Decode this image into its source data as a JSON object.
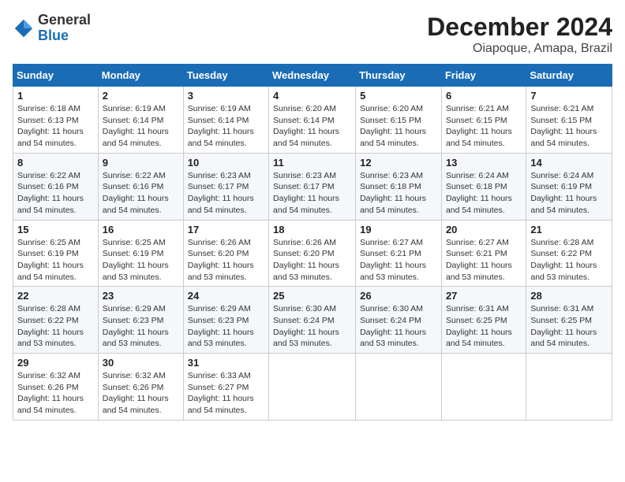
{
  "header": {
    "logo_general": "General",
    "logo_blue": "Blue",
    "month_title": "December 2024",
    "location": "Oiapoque, Amapa, Brazil"
  },
  "weekdays": [
    "Sunday",
    "Monday",
    "Tuesday",
    "Wednesday",
    "Thursday",
    "Friday",
    "Saturday"
  ],
  "weeks": [
    [
      {
        "day": "1",
        "info": "Sunrise: 6:18 AM\nSunset: 6:13 PM\nDaylight: 11 hours\nand 54 minutes."
      },
      {
        "day": "2",
        "info": "Sunrise: 6:19 AM\nSunset: 6:14 PM\nDaylight: 11 hours\nand 54 minutes."
      },
      {
        "day": "3",
        "info": "Sunrise: 6:19 AM\nSunset: 6:14 PM\nDaylight: 11 hours\nand 54 minutes."
      },
      {
        "day": "4",
        "info": "Sunrise: 6:20 AM\nSunset: 6:14 PM\nDaylight: 11 hours\nand 54 minutes."
      },
      {
        "day": "5",
        "info": "Sunrise: 6:20 AM\nSunset: 6:15 PM\nDaylight: 11 hours\nand 54 minutes."
      },
      {
        "day": "6",
        "info": "Sunrise: 6:21 AM\nSunset: 6:15 PM\nDaylight: 11 hours\nand 54 minutes."
      },
      {
        "day": "7",
        "info": "Sunrise: 6:21 AM\nSunset: 6:15 PM\nDaylight: 11 hours\nand 54 minutes."
      }
    ],
    [
      {
        "day": "8",
        "info": "Sunrise: 6:22 AM\nSunset: 6:16 PM\nDaylight: 11 hours\nand 54 minutes."
      },
      {
        "day": "9",
        "info": "Sunrise: 6:22 AM\nSunset: 6:16 PM\nDaylight: 11 hours\nand 54 minutes."
      },
      {
        "day": "10",
        "info": "Sunrise: 6:23 AM\nSunset: 6:17 PM\nDaylight: 11 hours\nand 54 minutes."
      },
      {
        "day": "11",
        "info": "Sunrise: 6:23 AM\nSunset: 6:17 PM\nDaylight: 11 hours\nand 54 minutes."
      },
      {
        "day": "12",
        "info": "Sunrise: 6:23 AM\nSunset: 6:18 PM\nDaylight: 11 hours\nand 54 minutes."
      },
      {
        "day": "13",
        "info": "Sunrise: 6:24 AM\nSunset: 6:18 PM\nDaylight: 11 hours\nand 54 minutes."
      },
      {
        "day": "14",
        "info": "Sunrise: 6:24 AM\nSunset: 6:19 PM\nDaylight: 11 hours\nand 54 minutes."
      }
    ],
    [
      {
        "day": "15",
        "info": "Sunrise: 6:25 AM\nSunset: 6:19 PM\nDaylight: 11 hours\nand 54 minutes."
      },
      {
        "day": "16",
        "info": "Sunrise: 6:25 AM\nSunset: 6:19 PM\nDaylight: 11 hours\nand 53 minutes."
      },
      {
        "day": "17",
        "info": "Sunrise: 6:26 AM\nSunset: 6:20 PM\nDaylight: 11 hours\nand 53 minutes."
      },
      {
        "day": "18",
        "info": "Sunrise: 6:26 AM\nSunset: 6:20 PM\nDaylight: 11 hours\nand 53 minutes."
      },
      {
        "day": "19",
        "info": "Sunrise: 6:27 AM\nSunset: 6:21 PM\nDaylight: 11 hours\nand 53 minutes."
      },
      {
        "day": "20",
        "info": "Sunrise: 6:27 AM\nSunset: 6:21 PM\nDaylight: 11 hours\nand 53 minutes."
      },
      {
        "day": "21",
        "info": "Sunrise: 6:28 AM\nSunset: 6:22 PM\nDaylight: 11 hours\nand 53 minutes."
      }
    ],
    [
      {
        "day": "22",
        "info": "Sunrise: 6:28 AM\nSunset: 6:22 PM\nDaylight: 11 hours\nand 53 minutes."
      },
      {
        "day": "23",
        "info": "Sunrise: 6:29 AM\nSunset: 6:23 PM\nDaylight: 11 hours\nand 53 minutes."
      },
      {
        "day": "24",
        "info": "Sunrise: 6:29 AM\nSunset: 6:23 PM\nDaylight: 11 hours\nand 53 minutes."
      },
      {
        "day": "25",
        "info": "Sunrise: 6:30 AM\nSunset: 6:24 PM\nDaylight: 11 hours\nand 53 minutes."
      },
      {
        "day": "26",
        "info": "Sunrise: 6:30 AM\nSunset: 6:24 PM\nDaylight: 11 hours\nand 53 minutes."
      },
      {
        "day": "27",
        "info": "Sunrise: 6:31 AM\nSunset: 6:25 PM\nDaylight: 11 hours\nand 54 minutes."
      },
      {
        "day": "28",
        "info": "Sunrise: 6:31 AM\nSunset: 6:25 PM\nDaylight: 11 hours\nand 54 minutes."
      }
    ],
    [
      {
        "day": "29",
        "info": "Sunrise: 6:32 AM\nSunset: 6:26 PM\nDaylight: 11 hours\nand 54 minutes."
      },
      {
        "day": "30",
        "info": "Sunrise: 6:32 AM\nSunset: 6:26 PM\nDaylight: 11 hours\nand 54 minutes."
      },
      {
        "day": "31",
        "info": "Sunrise: 6:33 AM\nSunset: 6:27 PM\nDaylight: 11 hours\nand 54 minutes."
      },
      {
        "day": "",
        "info": ""
      },
      {
        "day": "",
        "info": ""
      },
      {
        "day": "",
        "info": ""
      },
      {
        "day": "",
        "info": ""
      }
    ]
  ]
}
